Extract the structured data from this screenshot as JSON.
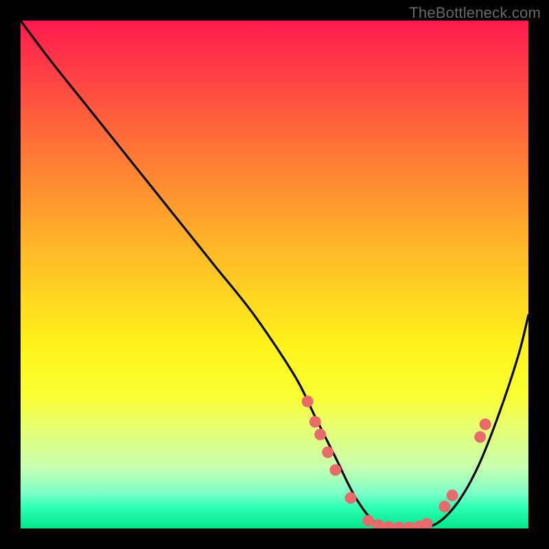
{
  "watermark": "TheBottleneck.com",
  "chart_data": {
    "type": "line",
    "title": "",
    "xlabel": "",
    "ylabel": "",
    "xlim": [
      0,
      100
    ],
    "ylim": [
      0,
      100
    ],
    "series": [
      {
        "name": "bottleneck-curve",
        "x": [
          0,
          6,
          14,
          22,
          30,
          38,
          46,
          54,
          58,
          62,
          66,
          70,
          74,
          78,
          82,
          86,
          90,
          94,
          98,
          100
        ],
        "y": [
          100,
          92,
          82,
          72,
          62,
          52,
          42,
          30,
          22,
          14,
          6,
          1,
          0,
          0,
          1,
          5,
          12,
          22,
          34,
          42
        ]
      }
    ],
    "markers": [
      {
        "x": 56.5,
        "y": 25.0
      },
      {
        "x": 58.0,
        "y": 21.0
      },
      {
        "x": 59.0,
        "y": 18.5
      },
      {
        "x": 60.5,
        "y": 15.0
      },
      {
        "x": 62.0,
        "y": 11.5
      },
      {
        "x": 65.0,
        "y": 6.0
      },
      {
        "x": 68.5,
        "y": 1.5
      },
      {
        "x": 70.5,
        "y": 0.6
      },
      {
        "x": 72.5,
        "y": 0.3
      },
      {
        "x": 74.5,
        "y": 0.2
      },
      {
        "x": 76.5,
        "y": 0.2
      },
      {
        "x": 78.5,
        "y": 0.4
      },
      {
        "x": 80.0,
        "y": 0.9
      },
      {
        "x": 83.5,
        "y": 4.3
      },
      {
        "x": 85.0,
        "y": 6.5
      },
      {
        "x": 90.5,
        "y": 18.0
      },
      {
        "x": 91.5,
        "y": 20.5
      }
    ],
    "colors": {
      "curve": "#000000",
      "marker": "#e86a6a"
    }
  }
}
